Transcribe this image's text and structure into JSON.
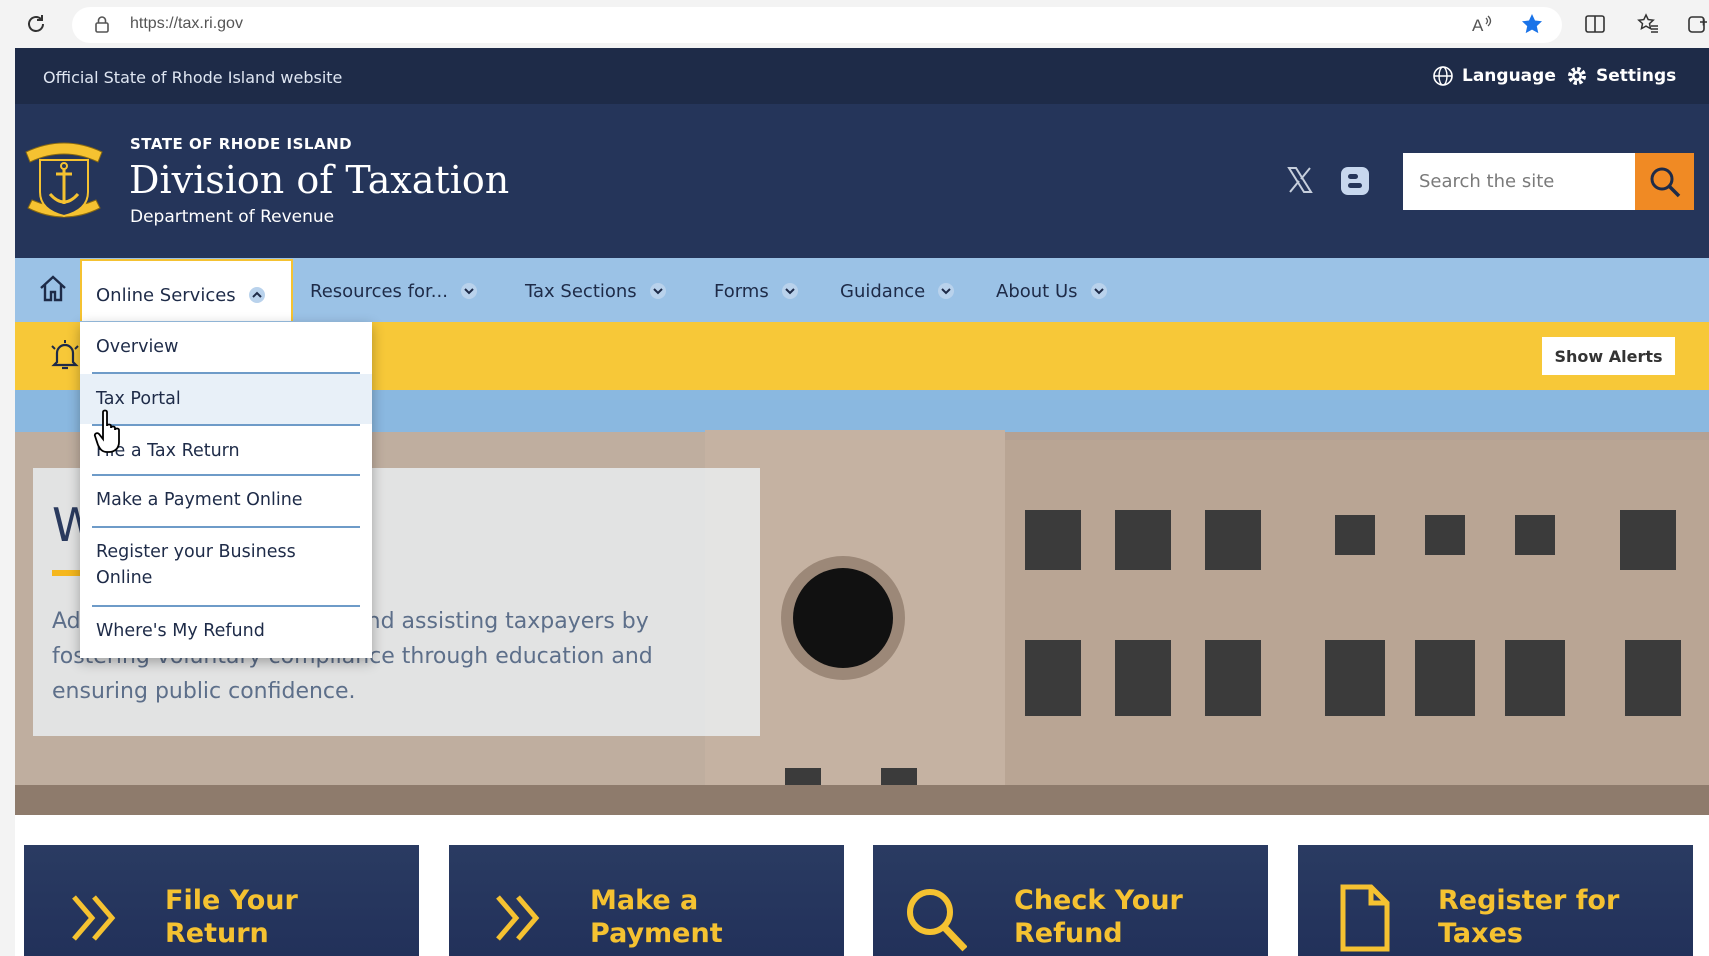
{
  "browser": {
    "url": "https://tax.ri.gov",
    "icons": [
      "reload-icon",
      "lock-icon",
      "read-aloud-icon",
      "favorite-star-icon",
      "split-screen-icon",
      "favorites-icon",
      "extensions-icon"
    ]
  },
  "official_bar": {
    "text": "Official State of Rhode Island website",
    "language_label": "Language",
    "settings_label": "Settings"
  },
  "header": {
    "state": "STATE OF RHODE ISLAND",
    "title": "Division of Taxation",
    "subtitle": "Department of Revenue",
    "search_placeholder": "Search the site"
  },
  "nav": {
    "items": [
      {
        "label": "Online Services",
        "expanded": true
      },
      {
        "label": "Resources for..."
      },
      {
        "label": "Tax Sections"
      },
      {
        "label": "Forms"
      },
      {
        "label": "Guidance"
      },
      {
        "label": "About Us"
      }
    ]
  },
  "dropdown": {
    "items": [
      {
        "label": "Overview"
      },
      {
        "label": "Tax Portal"
      },
      {
        "label": "File a Tax Return"
      },
      {
        "label": "Make a Payment Online"
      },
      {
        "label": "Register your Business Online"
      },
      {
        "label": "Where's My Refund"
      }
    ]
  },
  "alerts": {
    "button": "Show Alerts"
  },
  "hero": {
    "heading": "W",
    "text": "Administering the tax laws and assisting taxpayers by fostering voluntary compliance through education and ensuring public confidence."
  },
  "cards": [
    {
      "label": "File Your Return",
      "icon": "double-chevron-icon"
    },
    {
      "label": "Make a Payment",
      "icon": "double-chevron-icon"
    },
    {
      "label": "Check Your Refund",
      "icon": "magnifier-icon"
    },
    {
      "label": "Register for Taxes",
      "icon": "document-icon"
    }
  ],
  "colors": {
    "navy": "#1e2b48",
    "header": "#25355a",
    "nav": "#9bc2e6",
    "alert": "#f7c838",
    "accent": "#f08a24",
    "card_text": "#f5c231"
  }
}
